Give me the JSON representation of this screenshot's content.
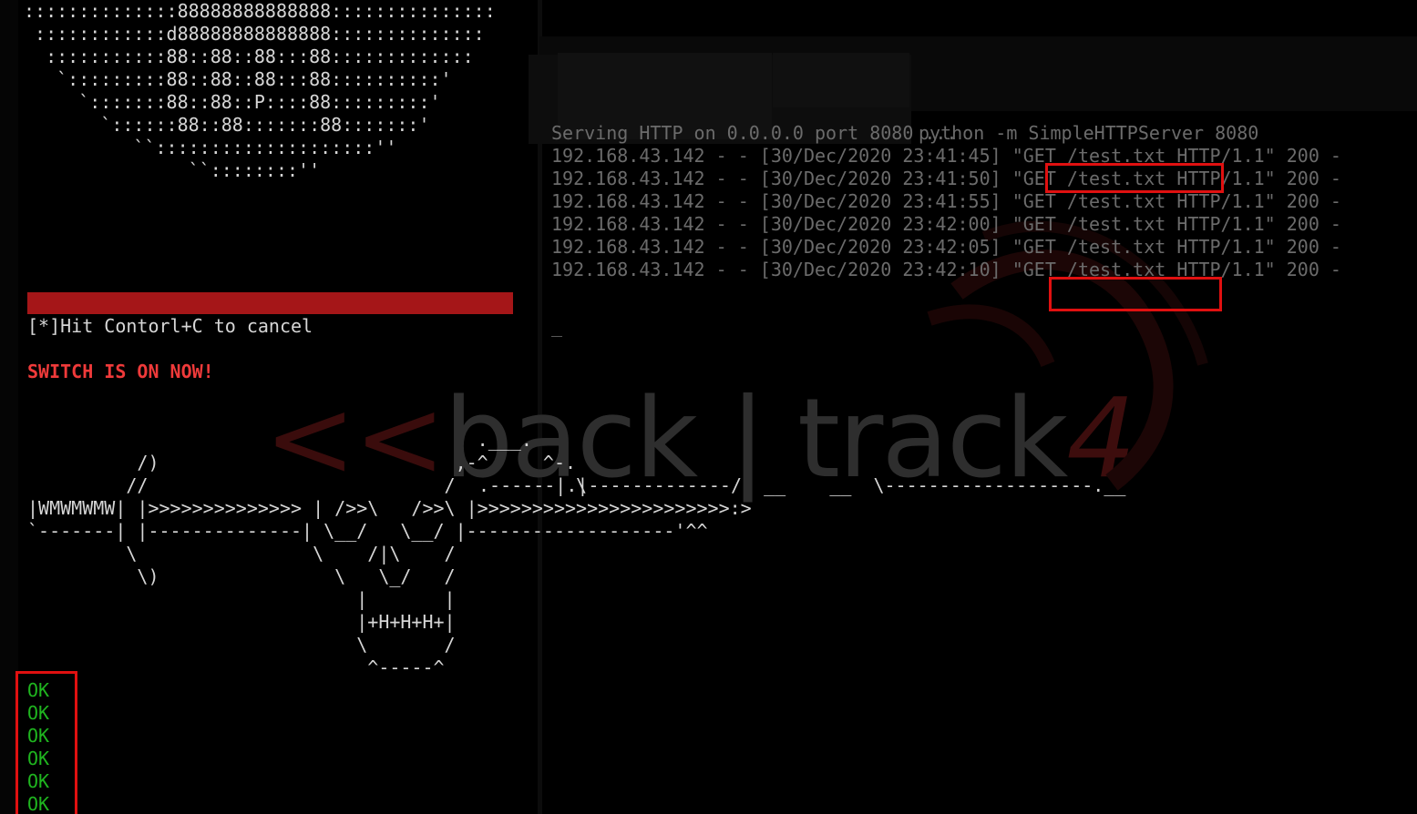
{
  "left_terminal": {
    "banner": [
      "::::::::::::::88888888888888:::::::::::::::",
      " ::::::::::::d88888888888888::::::::::::::",
      "  :::::::::::88::88::88:::88:::::::::::::",
      "   `:::::::::88::88::88:::88::::::::::'",
      "     `:::::::88::88::P::::88:::::::::'",
      "       `::::::88::88:::::::88:::::::'",
      "          ``::::::::::::::::::::''",
      "               ``::::::::''"
    ],
    "hint": "[*]Hit Contorl+C to cancel",
    "status": "SWITCH IS ON NOW!",
    "art": [
      "                                         .___.",
      "          /)                           ,-^     ^-.",
      "         //                           /           \\",
      "|WMWMWMW| |>>>>>>>>>>>>>> | />>\\   />>\\ |>>>>>>>>>>>>>>>>>>>>>>>:>",
      "`-------| |--------------| \\__/   \\__/ |-------------------'^^",
      "         \\                \\    /|\\    /",
      "          \\)                \\   \\_/   /",
      "                              |       |",
      "                              |+H+H+H+|",
      "                              \\       /",
      "                               ^-----^"
    ],
    "ok_lines": [
      "OK",
      "OK",
      "OK",
      "OK",
      "OK",
      "OK"
    ]
  },
  "right_terminal": {
    "command": "python -m SimpleHTTPServer 8080",
    "lines": [
      "Serving HTTP on 0.0.0.0 port 8080 ...",
      "192.168.43.142 - - [30/Dec/2020 23:41:45] \"GET /test.txt HTTP/1.1\" 200 -",
      "192.168.43.142 - - [30/Dec/2020 23:41:50] \"GET /test.txt HTTP/1.1\" 200 -",
      "192.168.43.142 - - [30/Dec/2020 23:41:55] \"GET /test.txt HTTP/1.1\" 200 -",
      "192.168.43.142 - - [30/Dec/2020 23:42:00] \"GET /test.txt HTTP/1.1\" 200 -",
      "192.168.43.142 - - [30/Dec/2020 23:42:05] \"GET /test.txt HTTP/1.1\" 200 -",
      "192.168.43.142 - - [30/Dec/2020 23:42:10] \"GET /test.txt HTTP/1.1\" 200 -"
    ],
    "cursor": "_",
    "art_tail": ".------|.|-------------/  __    __  \\-------------------.__"
  },
  "watermark": {
    "arrows": "<<",
    "text": "back | track",
    "digit": "4"
  },
  "colors": {
    "background": "#000000",
    "text": "#d6d6d6",
    "dim_text": "#6b6b6b",
    "status_red": "#ef3a3a",
    "ok_green": "#1fb51f",
    "highlight_red": "#e01010",
    "bar_red": "#a51618"
  }
}
